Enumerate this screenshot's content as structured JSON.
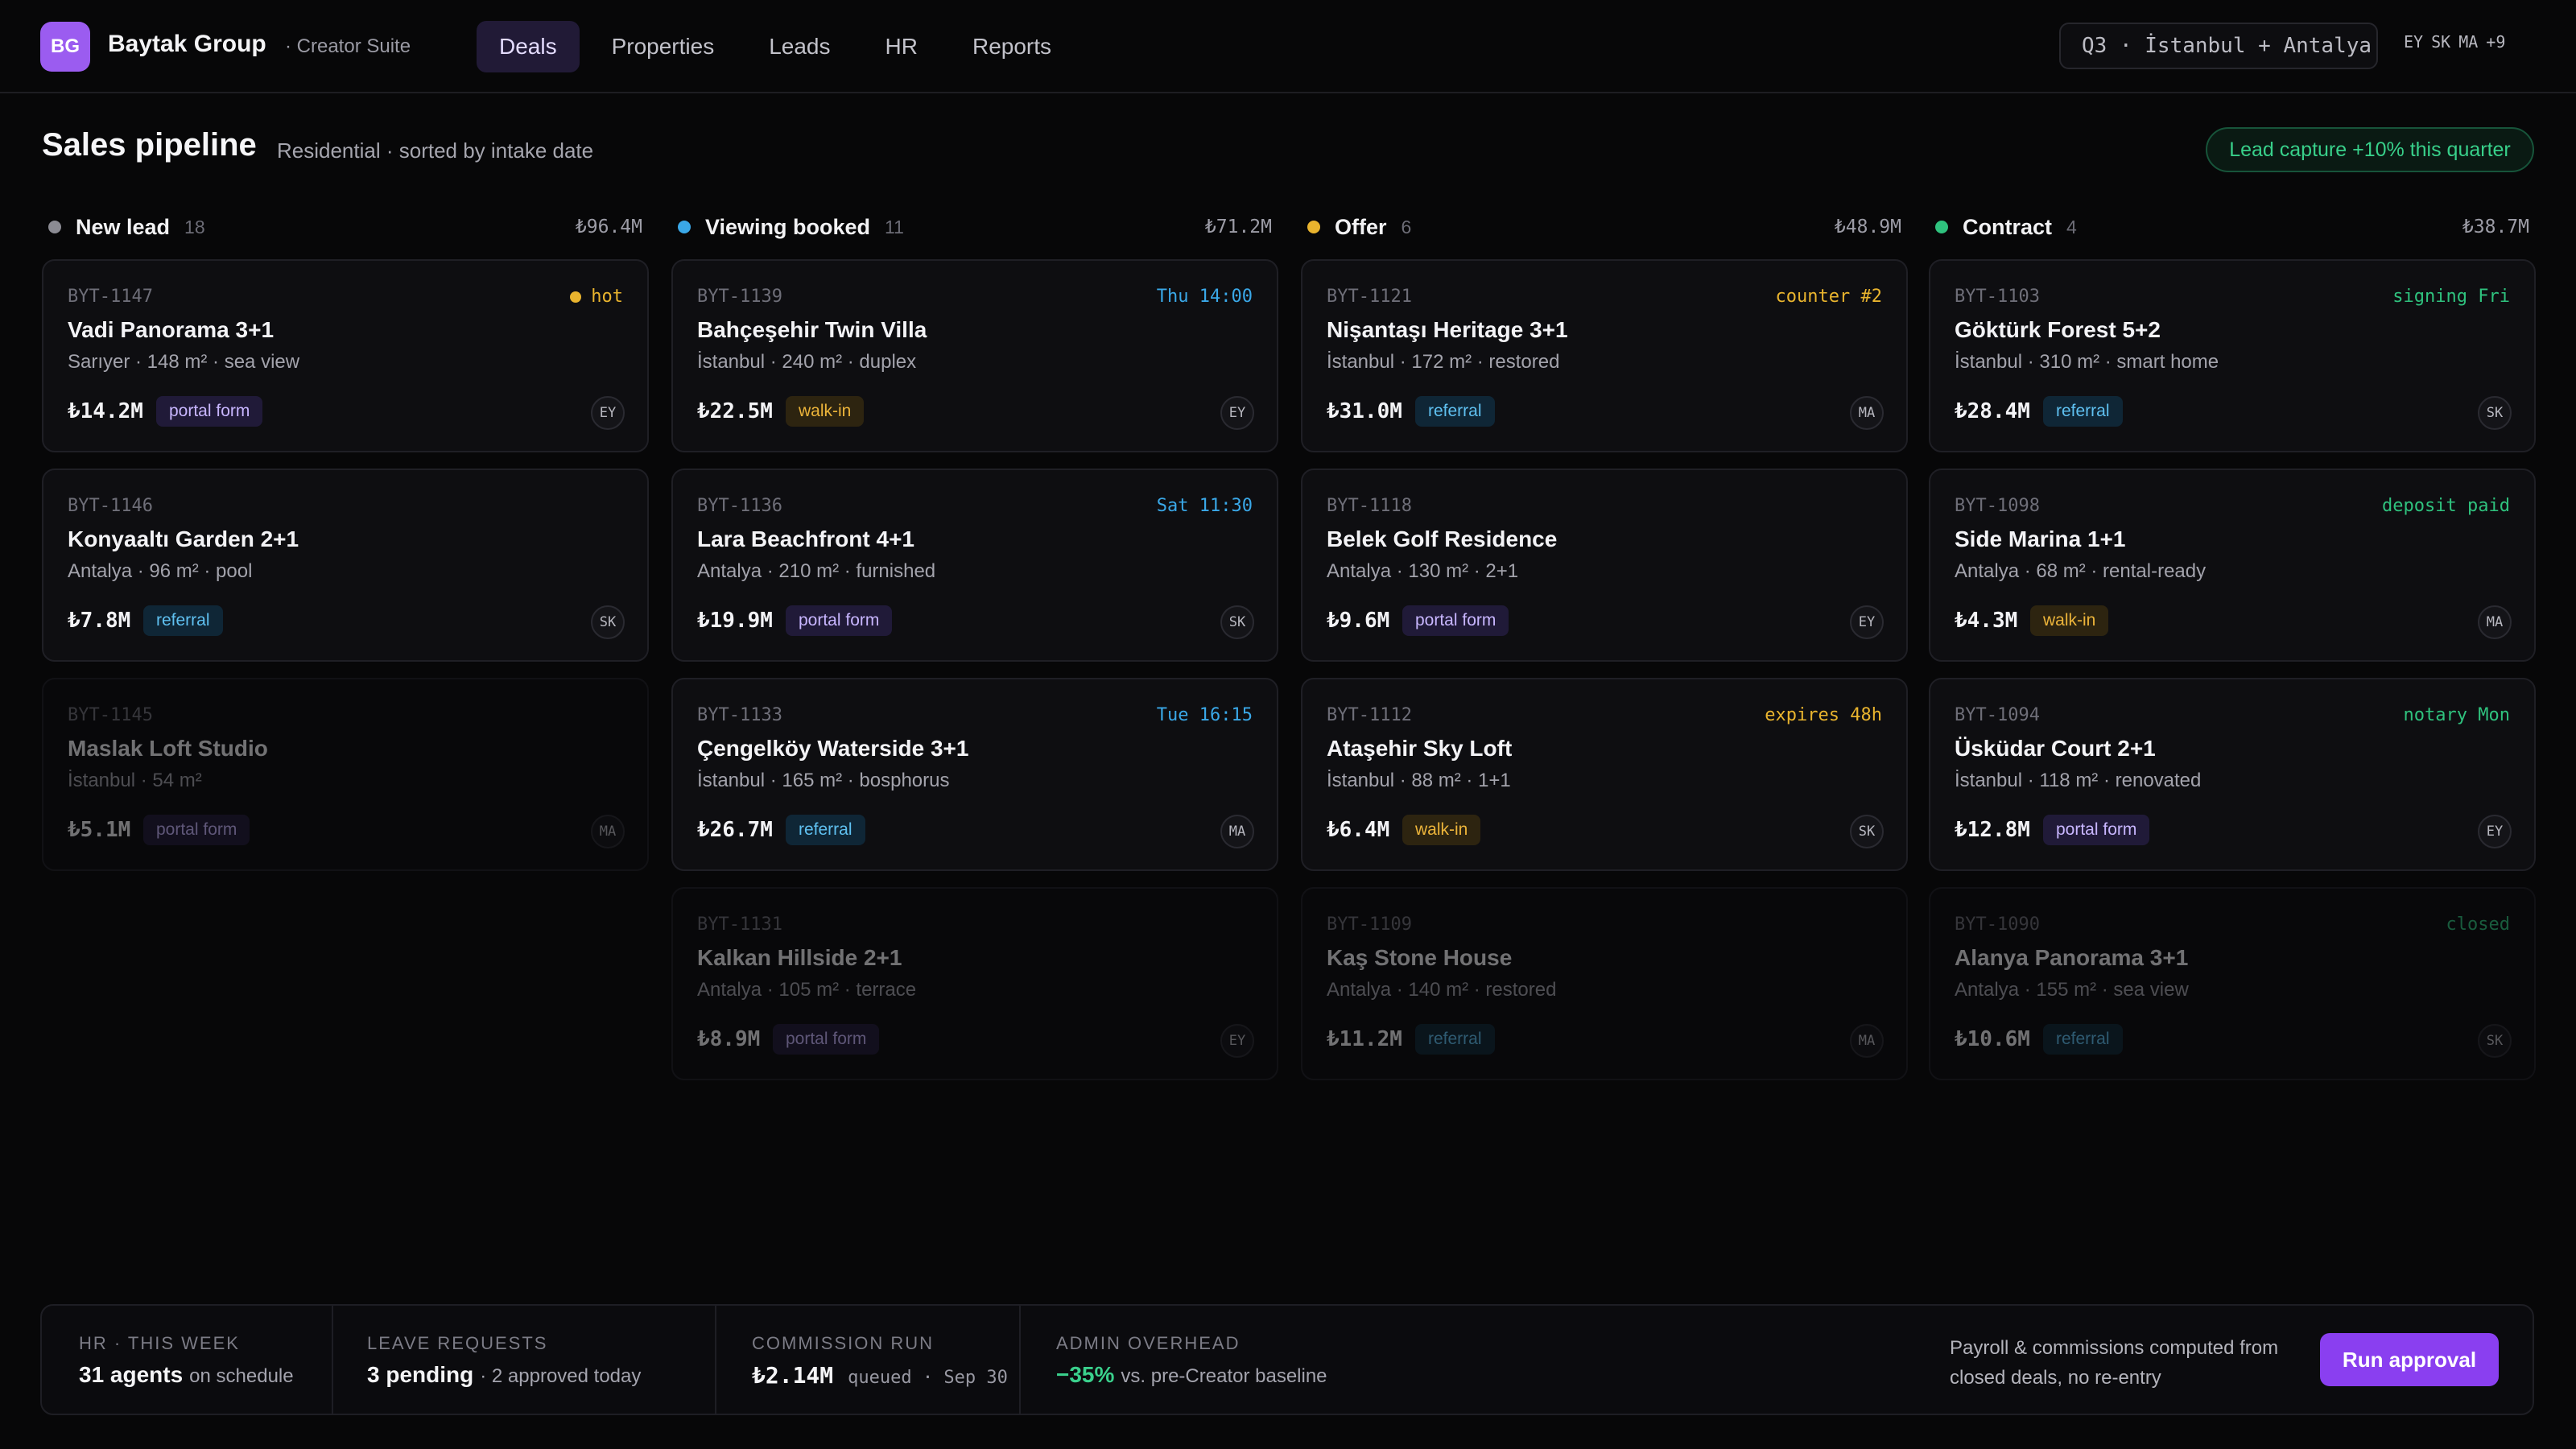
{
  "brand": {
    "initials": "BG",
    "name": "Baytak Group",
    "sub": "· Creator Suite"
  },
  "nav": {
    "tabs": [
      {
        "label": "Deals",
        "active": true
      },
      {
        "label": "Properties"
      },
      {
        "label": "Leads"
      },
      {
        "label": "HR"
      },
      {
        "label": "Reports"
      }
    ]
  },
  "scope": "Q3 · İstanbul + Antalya",
  "team": {
    "avatars": [
      "EY",
      "SK",
      "MA"
    ],
    "more": "+9"
  },
  "page": {
    "title": "Sales pipeline",
    "subtitle": "Residential · sorted by intake date",
    "capture_badge": "Lead capture +10% this quarter"
  },
  "colors": {
    "new_lead": "#8b8b93",
    "viewing": "#3aa8e8",
    "offer": "#e9b42e",
    "contract": "#2fc27e",
    "accent": "#8a3ff0"
  },
  "columns": [
    {
      "title": "New lead",
      "count": "18",
      "total": "₺96.4M",
      "cards": [
        {
          "id": "BYT-1147",
          "flag": "hot",
          "name": "Vadi Panorama 3+1",
          "meta": "Sarıyer · 148 m² · sea view",
          "price": "₺14.2M",
          "source": "portal form",
          "agent": "EY"
        },
        {
          "id": "BYT-1146",
          "flag": "",
          "name": "Konyaaltı Garden 2+1",
          "meta": "Antalya · 96 m² · pool",
          "price": "₺7.8M",
          "source": "referral",
          "agent": "SK"
        },
        {
          "id": "BYT-1145",
          "flag": "",
          "name": "Maslak Loft Studio",
          "meta": "İstanbul · 54 m²",
          "price": "₺5.1M",
          "source": "portal form",
          "agent": "MA"
        }
      ]
    },
    {
      "title": "Viewing booked",
      "count": "11",
      "total": "₺71.2M",
      "cards": [
        {
          "id": "BYT-1139",
          "flag": "Thu 14:00",
          "name": "Bahçeşehir Twin Villa",
          "meta": "İstanbul · 240 m² · duplex",
          "price": "₺22.5M",
          "source": "walk-in",
          "agent": "EY"
        },
        {
          "id": "BYT-1136",
          "flag": "Sat 11:30",
          "name": "Lara Beachfront 4+1",
          "meta": "Antalya · 210 m² · furnished",
          "price": "₺19.9M",
          "source": "portal form",
          "agent": "SK"
        },
        {
          "id": "BYT-1133",
          "flag": "Tue 16:15",
          "name": "Çengelköy Waterside 3+1",
          "meta": "İstanbul · 165 m² · bosphorus",
          "price": "₺26.7M",
          "source": "referral",
          "agent": "MA"
        },
        {
          "id": "BYT-1131",
          "flag": "",
          "name": "Kalkan Hillside 2+1",
          "meta": "Antalya · 105 m² · terrace",
          "price": "₺8.9M",
          "source": "portal form",
          "agent": "EY"
        }
      ]
    },
    {
      "title": "Offer",
      "count": "6",
      "total": "₺48.9M",
      "cards": [
        {
          "id": "BYT-1121",
          "flag": "counter #2",
          "name": "Nişantaşı Heritage 3+1",
          "meta": "İstanbul · 172 m² · restored",
          "price": "₺31.0M",
          "source": "referral",
          "agent": "MA"
        },
        {
          "id": "BYT-1118",
          "flag": "",
          "name": "Belek Golf Residence",
          "meta": "Antalya · 130 m² · 2+1",
          "price": "₺9.6M",
          "source": "portal form",
          "agent": "EY"
        },
        {
          "id": "BYT-1112",
          "flag": "expires 48h",
          "name": "Ataşehir Sky Loft",
          "meta": "İstanbul · 88 m² · 1+1",
          "price": "₺6.4M",
          "source": "walk-in",
          "agent": "SK"
        },
        {
          "id": "BYT-1109",
          "flag": "",
          "name": "Kaş Stone House",
          "meta": "Antalya · 140 m² · restored",
          "price": "₺11.2M",
          "source": "referral",
          "agent": "MA"
        }
      ]
    },
    {
      "title": "Contract",
      "count": "4",
      "total": "₺38.7M",
      "cards": [
        {
          "id": "BYT-1103",
          "flag": "signing Fri",
          "name": "Göktürk Forest 5+2",
          "meta": "İstanbul · 310 m² · smart home",
          "price": "₺28.4M",
          "source": "referral",
          "agent": "SK"
        },
        {
          "id": "BYT-1098",
          "flag": "deposit paid",
          "name": "Side Marina 1+1",
          "meta": "Antalya · 68 m² · rental-ready",
          "price": "₺4.3M",
          "source": "walk-in",
          "agent": "MA"
        },
        {
          "id": "BYT-1094",
          "flag": "notary Mon",
          "name": "Üsküdar Court 2+1",
          "meta": "İstanbul · 118 m² · renovated",
          "price": "₺12.8M",
          "source": "portal form",
          "agent": "EY"
        },
        {
          "id": "BYT-1090",
          "flag": "closed",
          "name": "Alanya Panorama 3+1",
          "meta": "Antalya · 155 m² · sea view",
          "price": "₺10.6M",
          "source": "referral",
          "agent": "SK"
        }
      ]
    }
  ],
  "footer": {
    "hr": {
      "label": "HR · THIS WEEK",
      "value": "31 agents",
      "note": "on schedule"
    },
    "leave": {
      "label": "LEAVE REQUESTS",
      "value": "3 pending",
      "note": "· 2 approved today"
    },
    "commission": {
      "label": "COMMISSION RUN",
      "value": "₺2.14M",
      "note": "queued · Sep 30"
    },
    "overhead": {
      "label": "ADMIN OVERHEAD",
      "value": "−35%",
      "note": "vs. pre-Creator baseline"
    },
    "summary": "Payroll & commissions computed from closed deals, no re-entry",
    "run_label": "Run approval"
  }
}
